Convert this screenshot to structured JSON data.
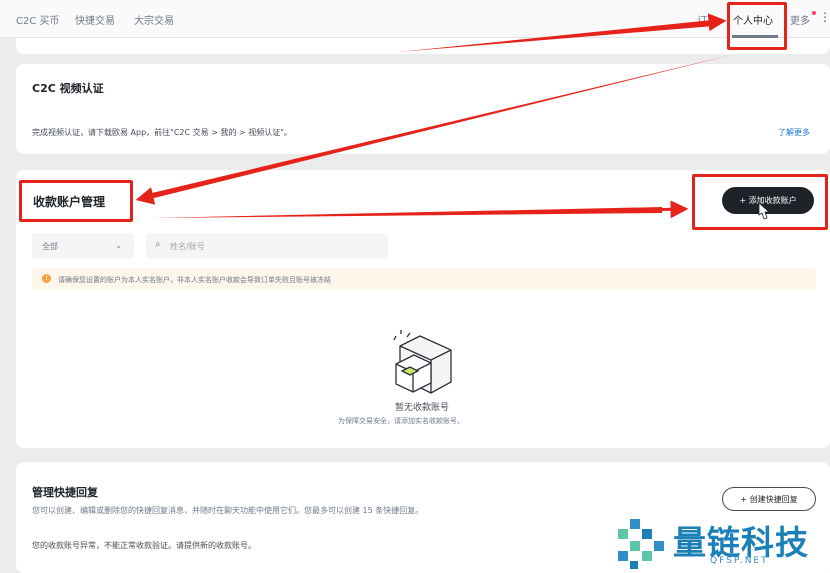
{
  "topnav": {
    "items": [
      "C2C 买币",
      "快捷交易",
      "大宗交易"
    ],
    "right_partial": "订",
    "personal_center": "个人中心",
    "more": "更多"
  },
  "video_cert": {
    "title": "C2C 视频认证",
    "desc": "完成视频认证，请下载欧易 App，前往\"C2C 交易 > 我的 > 视频认证\"。",
    "learn_more": "了解更多"
  },
  "account_mgmt": {
    "title": "收款账户管理",
    "add_button": "+ 添加收款账户",
    "filter_selected": "全部",
    "search_placeholder": "姓名/账号",
    "warning": "请确保您设置的账户为本人实名账户，非本人实名账户收款会导致订单失败且账号被冻结",
    "empty_title": "暂无收款账号",
    "empty_sub": "为保障交易安全，请添加实名收款账号。"
  },
  "quick_reply": {
    "title": "管理快捷回复",
    "desc": "您可以创建、编辑或删除您的快捷回复消息，并随时在聊天功能中使用它们。您最多可以创建 15 条快捷回复。",
    "create_button": "+ 创建快捷回复",
    "note": "您的收款账号异常，不能正常收款验证。请提供新的收款账号。"
  },
  "watermark": {
    "text": "量链科技",
    "sub": "QFSP.NET"
  },
  "colors": {
    "annotation_red": "#e6231a",
    "primary_dark": "#1e2329",
    "link_blue": "#1d77d8",
    "warning_orange": "#f0a33a"
  }
}
